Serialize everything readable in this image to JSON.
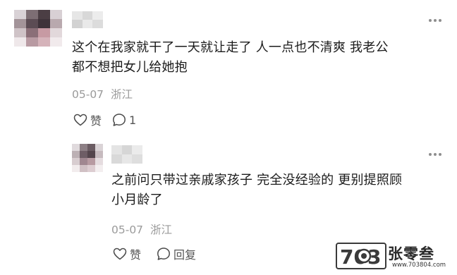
{
  "comments": [
    {
      "text_line1": "这个在我家就干了一天就让走了 人一点也不清爽 我老公",
      "text_line2": "都不想把女儿给她抱",
      "date": "05-07",
      "location": "浙江",
      "like_label": "赞",
      "reply_count": "1"
    },
    {
      "text_line1": "之前问只带过亲戚家孩子 完全没经验的 更别提照顾",
      "text_line2": "小月龄了",
      "date": "05-07",
      "location": "浙江",
      "like_label": "赞",
      "reply_label": "回复"
    }
  ],
  "watermark": {
    "logo_text": "703",
    "brand": "张零叁",
    "url": "www.703804.com"
  },
  "colors": {
    "text": "#1b1b1b",
    "meta": "#9a9a9a",
    "action": "#555555",
    "icon": "#4a4a4a"
  },
  "icons": [
    "more-icon",
    "heart-icon",
    "comment-icon"
  ]
}
